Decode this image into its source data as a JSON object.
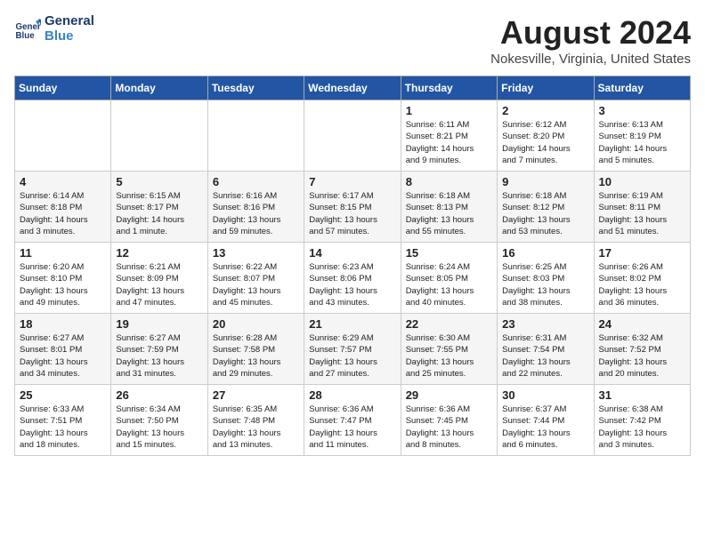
{
  "header": {
    "logo_line1": "General",
    "logo_line2": "Blue",
    "month_year": "August 2024",
    "location": "Nokesville, Virginia, United States"
  },
  "days_of_week": [
    "Sunday",
    "Monday",
    "Tuesday",
    "Wednesday",
    "Thursday",
    "Friday",
    "Saturday"
  ],
  "weeks": [
    [
      {
        "num": "",
        "info": ""
      },
      {
        "num": "",
        "info": ""
      },
      {
        "num": "",
        "info": ""
      },
      {
        "num": "",
        "info": ""
      },
      {
        "num": "1",
        "info": "Sunrise: 6:11 AM\nSunset: 8:21 PM\nDaylight: 14 hours\nand 9 minutes."
      },
      {
        "num": "2",
        "info": "Sunrise: 6:12 AM\nSunset: 8:20 PM\nDaylight: 14 hours\nand 7 minutes."
      },
      {
        "num": "3",
        "info": "Sunrise: 6:13 AM\nSunset: 8:19 PM\nDaylight: 14 hours\nand 5 minutes."
      }
    ],
    [
      {
        "num": "4",
        "info": "Sunrise: 6:14 AM\nSunset: 8:18 PM\nDaylight: 14 hours\nand 3 minutes."
      },
      {
        "num": "5",
        "info": "Sunrise: 6:15 AM\nSunset: 8:17 PM\nDaylight: 14 hours\nand 1 minute."
      },
      {
        "num": "6",
        "info": "Sunrise: 6:16 AM\nSunset: 8:16 PM\nDaylight: 13 hours\nand 59 minutes."
      },
      {
        "num": "7",
        "info": "Sunrise: 6:17 AM\nSunset: 8:15 PM\nDaylight: 13 hours\nand 57 minutes."
      },
      {
        "num": "8",
        "info": "Sunrise: 6:18 AM\nSunset: 8:13 PM\nDaylight: 13 hours\nand 55 minutes."
      },
      {
        "num": "9",
        "info": "Sunrise: 6:18 AM\nSunset: 8:12 PM\nDaylight: 13 hours\nand 53 minutes."
      },
      {
        "num": "10",
        "info": "Sunrise: 6:19 AM\nSunset: 8:11 PM\nDaylight: 13 hours\nand 51 minutes."
      }
    ],
    [
      {
        "num": "11",
        "info": "Sunrise: 6:20 AM\nSunset: 8:10 PM\nDaylight: 13 hours\nand 49 minutes."
      },
      {
        "num": "12",
        "info": "Sunrise: 6:21 AM\nSunset: 8:09 PM\nDaylight: 13 hours\nand 47 minutes."
      },
      {
        "num": "13",
        "info": "Sunrise: 6:22 AM\nSunset: 8:07 PM\nDaylight: 13 hours\nand 45 minutes."
      },
      {
        "num": "14",
        "info": "Sunrise: 6:23 AM\nSunset: 8:06 PM\nDaylight: 13 hours\nand 43 minutes."
      },
      {
        "num": "15",
        "info": "Sunrise: 6:24 AM\nSunset: 8:05 PM\nDaylight: 13 hours\nand 40 minutes."
      },
      {
        "num": "16",
        "info": "Sunrise: 6:25 AM\nSunset: 8:03 PM\nDaylight: 13 hours\nand 38 minutes."
      },
      {
        "num": "17",
        "info": "Sunrise: 6:26 AM\nSunset: 8:02 PM\nDaylight: 13 hours\nand 36 minutes."
      }
    ],
    [
      {
        "num": "18",
        "info": "Sunrise: 6:27 AM\nSunset: 8:01 PM\nDaylight: 13 hours\nand 34 minutes."
      },
      {
        "num": "19",
        "info": "Sunrise: 6:27 AM\nSunset: 7:59 PM\nDaylight: 13 hours\nand 31 minutes."
      },
      {
        "num": "20",
        "info": "Sunrise: 6:28 AM\nSunset: 7:58 PM\nDaylight: 13 hours\nand 29 minutes."
      },
      {
        "num": "21",
        "info": "Sunrise: 6:29 AM\nSunset: 7:57 PM\nDaylight: 13 hours\nand 27 minutes."
      },
      {
        "num": "22",
        "info": "Sunrise: 6:30 AM\nSunset: 7:55 PM\nDaylight: 13 hours\nand 25 minutes."
      },
      {
        "num": "23",
        "info": "Sunrise: 6:31 AM\nSunset: 7:54 PM\nDaylight: 13 hours\nand 22 minutes."
      },
      {
        "num": "24",
        "info": "Sunrise: 6:32 AM\nSunset: 7:52 PM\nDaylight: 13 hours\nand 20 minutes."
      }
    ],
    [
      {
        "num": "25",
        "info": "Sunrise: 6:33 AM\nSunset: 7:51 PM\nDaylight: 13 hours\nand 18 minutes."
      },
      {
        "num": "26",
        "info": "Sunrise: 6:34 AM\nSunset: 7:50 PM\nDaylight: 13 hours\nand 15 minutes."
      },
      {
        "num": "27",
        "info": "Sunrise: 6:35 AM\nSunset: 7:48 PM\nDaylight: 13 hours\nand 13 minutes."
      },
      {
        "num": "28",
        "info": "Sunrise: 6:36 AM\nSunset: 7:47 PM\nDaylight: 13 hours\nand 11 minutes."
      },
      {
        "num": "29",
        "info": "Sunrise: 6:36 AM\nSunset: 7:45 PM\nDaylight: 13 hours\nand 8 minutes."
      },
      {
        "num": "30",
        "info": "Sunrise: 6:37 AM\nSunset: 7:44 PM\nDaylight: 13 hours\nand 6 minutes."
      },
      {
        "num": "31",
        "info": "Sunrise: 6:38 AM\nSunset: 7:42 PM\nDaylight: 13 hours\nand 3 minutes."
      }
    ]
  ]
}
